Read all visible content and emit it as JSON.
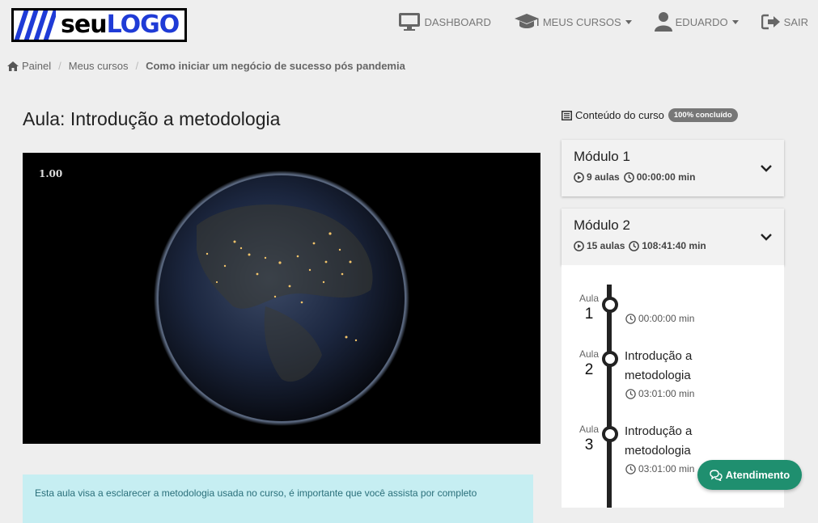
{
  "logo": {
    "seu": "seu",
    "logo": "LOGO"
  },
  "nav": {
    "dashboard": "DASHBOARD",
    "meus_cursos": "MEUS CURSOS",
    "user": "EDUARDO",
    "sair": "SAIR"
  },
  "breadcrumb": {
    "home": "Painel",
    "cursos": "Meus cursos",
    "current": "Como iniciar um negócio de sucesso pós pandemia"
  },
  "page_title": "Aula: Introdução a metodologia",
  "video": {
    "speed": "1.00"
  },
  "info_text": "Esta aula visa a esclarecer a metodologia usada no curso, é importante que você assista por completo",
  "content": {
    "title": "Conteúdo do curso",
    "badge": "100% concluído"
  },
  "modules": [
    {
      "title": "Módulo 1",
      "aulas": "9 aulas",
      "duration": "00:00:00 min"
    },
    {
      "title": "Módulo 2",
      "aulas": "15 aulas",
      "duration": "108:41:40 min"
    }
  ],
  "lessons": [
    {
      "label": "Aula",
      "num": "1",
      "title": "",
      "time": "00:00:00 min"
    },
    {
      "label": "Aula",
      "num": "2",
      "title": "Introdução a metodologia",
      "time": "03:01:00 min"
    },
    {
      "label": "Aula",
      "num": "3",
      "title": "Introdução a metodologia",
      "time": "03:01:00 min"
    }
  ],
  "atendimento": "Atendimento",
  "colors": {
    "accent": "#1f8f6f",
    "logo_blue": "#1f3bd6",
    "info_bg": "#c6eef2"
  }
}
